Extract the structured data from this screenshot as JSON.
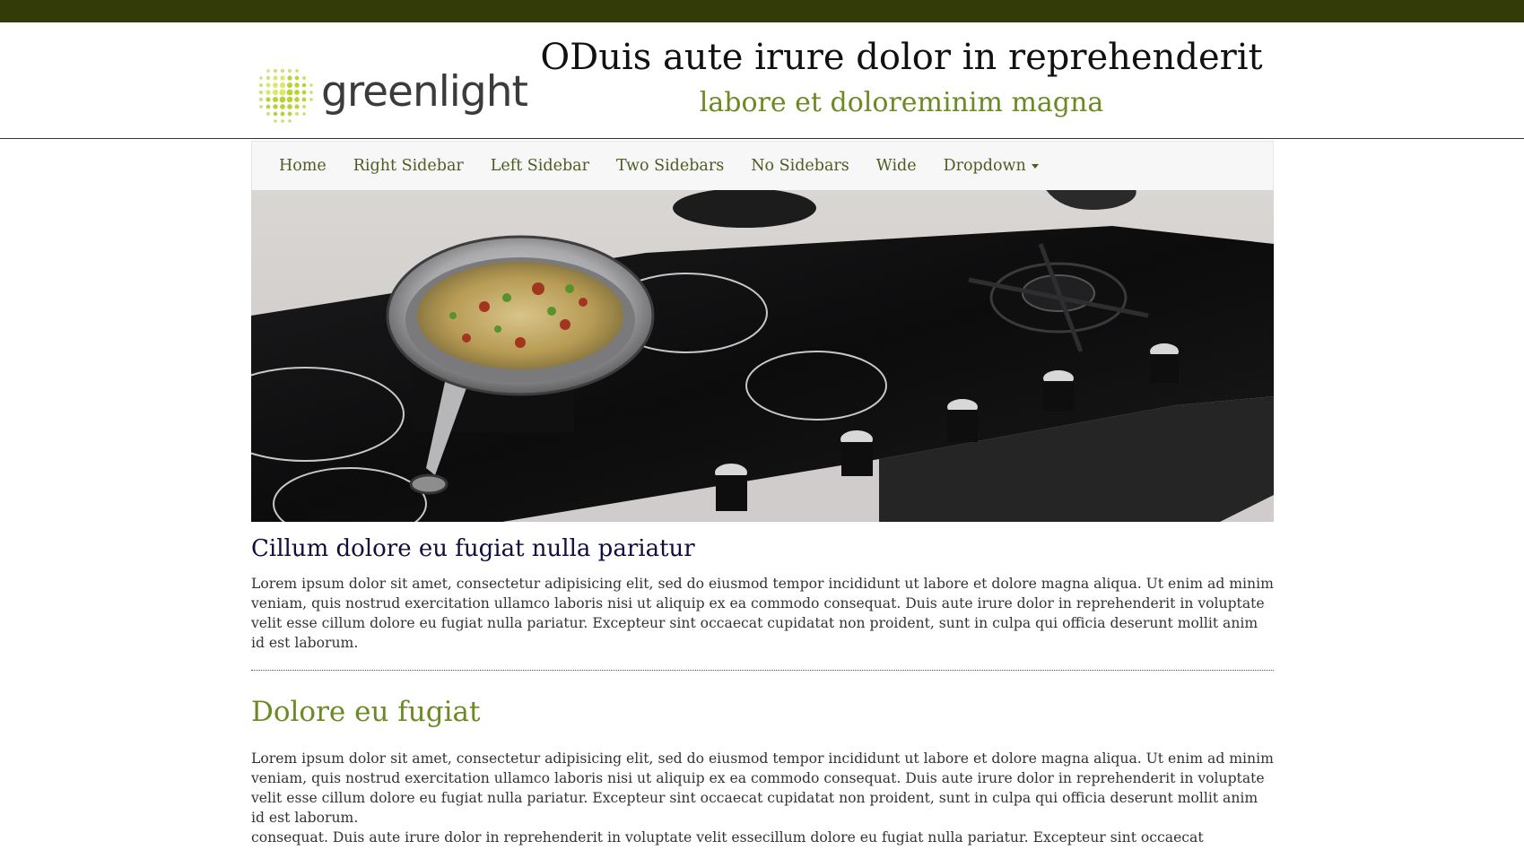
{
  "brand": {
    "logo_text": "greenlight",
    "accent": "#6b8a23",
    "topbar_color": "#333b09"
  },
  "header": {
    "title": "ODuis aute irure dolor in reprehenderit",
    "subtitle": "labore et doloreminim magna"
  },
  "nav": {
    "items": [
      {
        "label": "Home"
      },
      {
        "label": "Right Sidebar"
      },
      {
        "label": "Left Sidebar"
      },
      {
        "label": "Two Sidebars"
      },
      {
        "label": "No Sidebars"
      },
      {
        "label": "Wide"
      },
      {
        "label": "Dropdown",
        "icon": "caret-down-icon"
      }
    ]
  },
  "hero": {
    "description_icon": "kitchen-cooktop-image"
  },
  "article": {
    "title": "Cillum dolore eu fugiat nulla pariatur",
    "body": "Lorem ipsum dolor sit amet, consectetur adipisicing elit, sed do eiusmod tempor incididunt ut labore et dolore magna aliqua. Ut enim ad minim veniam, quis nostrud exercitation ullamco laboris nisi ut aliquip ex ea commodo consequat. Duis aute irure dolor in reprehenderit in voluptate velit esse cillum dolore eu fugiat nulla pariatur. Excepteur sint occaecat cupidatat non proident, sunt in culpa qui officia deserunt mollit anim id est laborum."
  },
  "section": {
    "title": "Dolore eu fugiat",
    "body_1": "Lorem ipsum dolor sit amet, consectetur adipisicing elit, sed do eiusmod tempor incididunt ut labore et dolore magna aliqua. Ut enim ad minim veniam, quis nostrud exercitation ullamco laboris nisi ut aliquip ex ea commodo consequat. Duis aute irure dolor in reprehenderit in voluptate velit esse cillum dolore eu fugiat nulla pariatur. Excepteur sint occaecat cupidatat non proident, sunt in culpa qui officia deserunt mollit anim id est laborum.",
    "body_2": "consequat. Duis aute irure dolor in reprehenderit in voluptate velit essecillum dolore eu fugiat nulla pariatur. Excepteur sint occaecat cupidatat non proident, sunt in culpa qui officia deserunt mollit anim id est laborum."
  }
}
